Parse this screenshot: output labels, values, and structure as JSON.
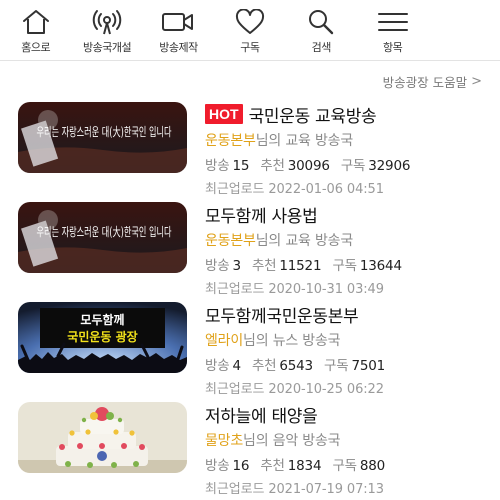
{
  "nav": {
    "items": [
      {
        "label": "홈으로",
        "icon": "home-icon"
      },
      {
        "label": "방송국개설",
        "icon": "broadcast-icon"
      },
      {
        "label": "방송제작",
        "icon": "video-camera-icon"
      },
      {
        "label": "구독",
        "icon": "heart-icon"
      },
      {
        "label": "검색",
        "icon": "search-icon"
      },
      {
        "label": "항목",
        "icon": "menu-icon"
      }
    ]
  },
  "help": {
    "label": "방송광장 도움말",
    "chevron": ">"
  },
  "labels": {
    "broadcast": "방송",
    "recommend": "추천",
    "subscribe": "구독",
    "recent_upload": "최근업로드",
    "owner_suffix": "님의"
  },
  "items": [
    {
      "hot": "HOT",
      "title": "국민운동 교육방송",
      "owner": "운동본부",
      "station": "교육 방송국",
      "broadcasts": "15",
      "recommends": "30096",
      "subscribers": "32906",
      "uploaded": "2022-01-06 04:51",
      "thumb_caption": "우리는 자랑스러운 대(大)한국인 입니다"
    },
    {
      "title": "모두함께 사용법",
      "owner": "운동본부",
      "station": "교육 방송국",
      "broadcasts": "3",
      "recommends": "11521",
      "subscribers": "13644",
      "uploaded": "2020-10-31 03:49",
      "thumb_caption": "우리는 자랑스러운 대(大)한국인 입니다"
    },
    {
      "title": "모두함께국민운동본부",
      "owner": "엘라이",
      "station": "뉴스 방송국",
      "broadcasts": "4",
      "recommends": "6543",
      "subscribers": "7501",
      "uploaded": "2020-10-25 06:22",
      "thumb_caption_line1": "모두함께",
      "thumb_caption_line2": "국민운동 광장"
    },
    {
      "title": "저하늘에 태양을",
      "owner": "물망초",
      "station": "음악 방송국",
      "broadcasts": "16",
      "recommends": "1834",
      "subscribers": "880",
      "uploaded": "2021-07-19 07:13"
    }
  ]
}
